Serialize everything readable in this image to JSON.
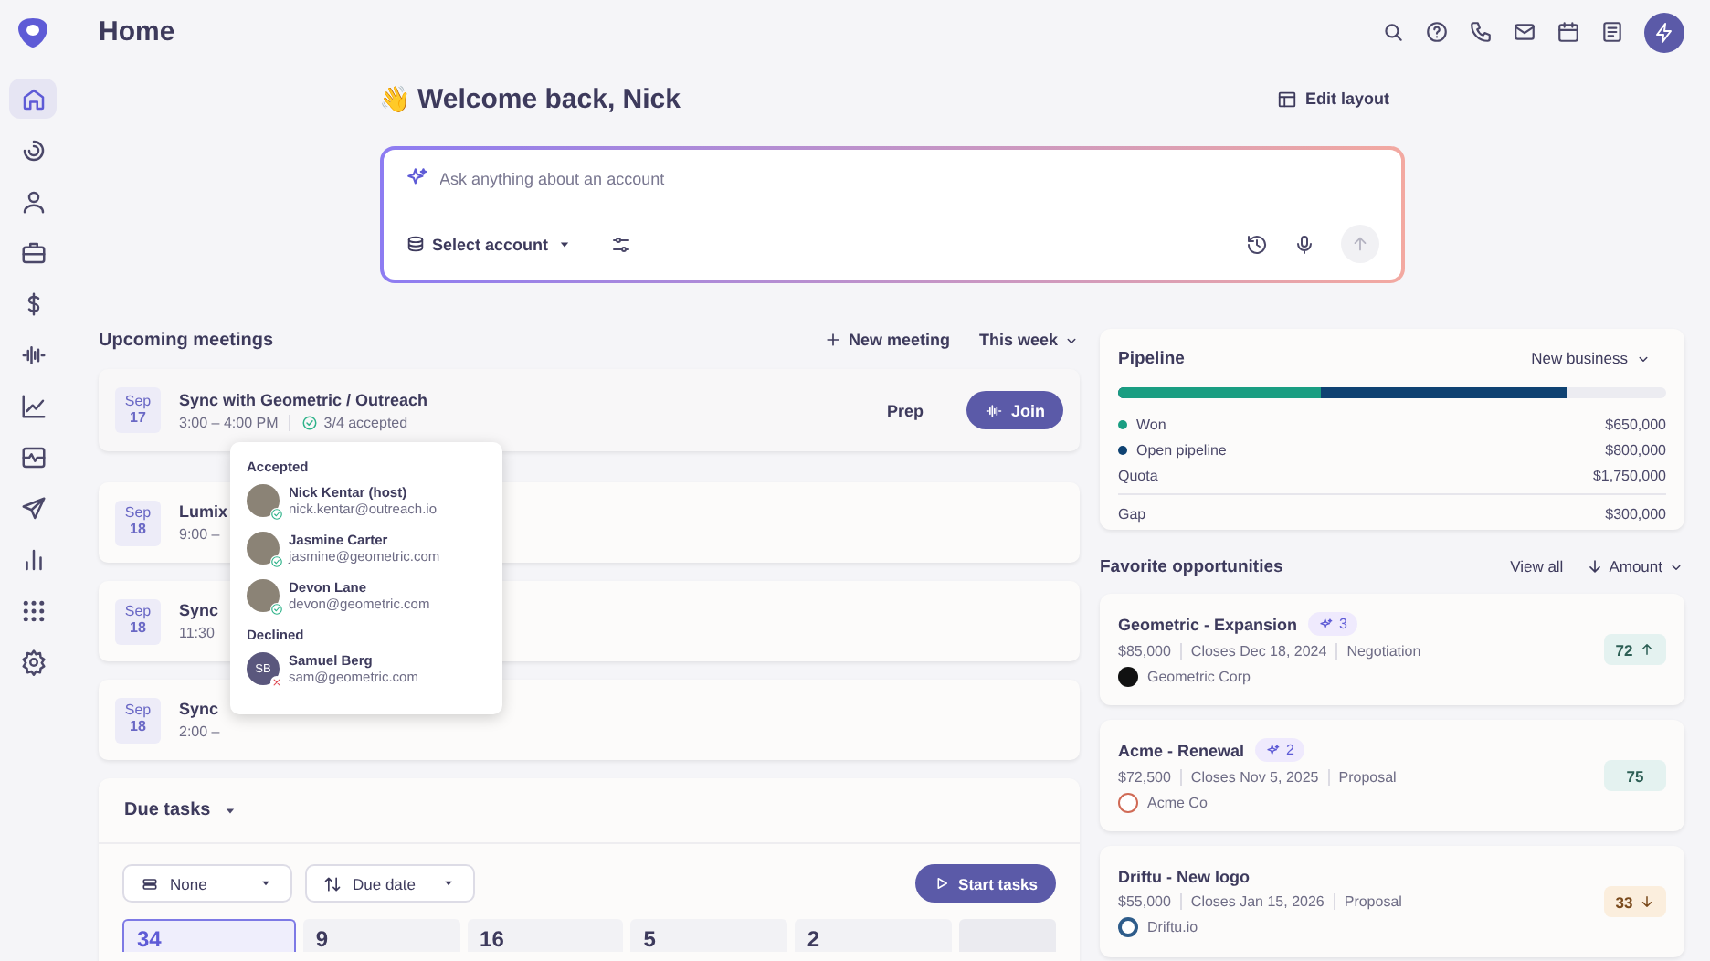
{
  "header": {
    "title": "Home"
  },
  "sidebar": {
    "items": [
      {
        "selected": true
      },
      {
        "selected": false
      },
      {
        "selected": false
      },
      {
        "selected": false
      },
      {
        "selected": false
      },
      {
        "selected": false
      },
      {
        "selected": false
      },
      {
        "selected": false
      },
      {
        "selected": false
      },
      {
        "selected": false
      },
      {
        "selected": false
      },
      {
        "selected": false
      }
    ]
  },
  "welcome": {
    "emoji": "👋",
    "title": "Welcome back, Nick",
    "edit_layout": "Edit layout"
  },
  "ask": {
    "placeholder": "Ask anything about an account",
    "account_select": "Select account"
  },
  "meetings": {
    "title": "Upcoming meetings",
    "new_meeting": "New meeting",
    "range": "This week",
    "items": [
      {
        "month": "Sep",
        "day": "17",
        "title": "Sync with Geometric / Outreach",
        "time": "3:00 – 4:00 PM",
        "rsvp": "3/4 accepted",
        "prep": "Prep",
        "join": "Join"
      },
      {
        "month": "Sep",
        "day": "18",
        "title": "Lumix",
        "time": "9:00 –"
      },
      {
        "month": "Sep",
        "day": "18",
        "title": "Sync",
        "time": "11:30"
      },
      {
        "month": "Sep",
        "day": "18",
        "title": "Sync",
        "time": "2:00 –"
      }
    ],
    "attendees": [
      {
        "label": "Accepted",
        "people": [
          {
            "name": "Nick Kentar (host)",
            "email": "nick.kentar@outreach.io",
            "accepted": true
          },
          {
            "name": "Jasmine Carter",
            "email": "jasmine@geometric.com",
            "accepted": true
          },
          {
            "name": "Devon Lane",
            "email": "devon@geometric.com",
            "accepted": true
          }
        ]
      },
      {
        "label": "Declined",
        "people": [
          {
            "name": "Samuel Berg",
            "email": "sam@geometric.com",
            "accepted": false,
            "initials": "SB"
          }
        ]
      }
    ]
  },
  "tasks": {
    "title": "Due tasks",
    "group_filter": "None",
    "sort_filter": "Due date",
    "start": "Start tasks",
    "tiles": [
      {
        "count": "34",
        "selected": true
      },
      {
        "count": "9",
        "selected": false
      },
      {
        "count": "16",
        "selected": false
      },
      {
        "count": "5",
        "selected": false
      },
      {
        "count": "2",
        "selected": false
      }
    ]
  },
  "pipeline": {
    "title": "Pipeline",
    "selector": "New business",
    "rows": [
      {
        "kind": "legend",
        "label": "Won",
        "value": "$650,000",
        "color": "#1a9e82",
        "level": 0.37
      },
      {
        "kind": "legend",
        "label": "Open pipeline",
        "value": "$800,000",
        "color": "#0f4272",
        "level": 0.82
      },
      {
        "kind": "plain",
        "label": "Quota",
        "value": "$1,750,000"
      },
      {
        "kind": "total",
        "label": "Gap",
        "value": "$300,000"
      }
    ]
  },
  "favorites": {
    "title": "Favorite opportunities",
    "view_all": "View all",
    "sort": "Amount",
    "items": [
      {
        "name": "Geometric - Expansion",
        "insights": "3",
        "amount": "$85,000",
        "closes": "Closes Dec 18, 2024",
        "stage": "Negotiation",
        "account": "Geometric Corp",
        "score": "72",
        "kind": "rising"
      },
      {
        "name": "Acme - Renewal",
        "insights": "2",
        "amount": "$72,500",
        "closes": "Closes Nov 5, 2025",
        "stage": "Proposal",
        "account": "Acme Co",
        "score": "75",
        "kind": "steady"
      },
      {
        "name": "Driftu - New logo",
        "amount": "$55,000",
        "closes": "Closes Jan 15, 2026",
        "stage": "Proposal",
        "account": "Driftu.io",
        "score": "33",
        "kind": "falling"
      }
    ]
  }
}
